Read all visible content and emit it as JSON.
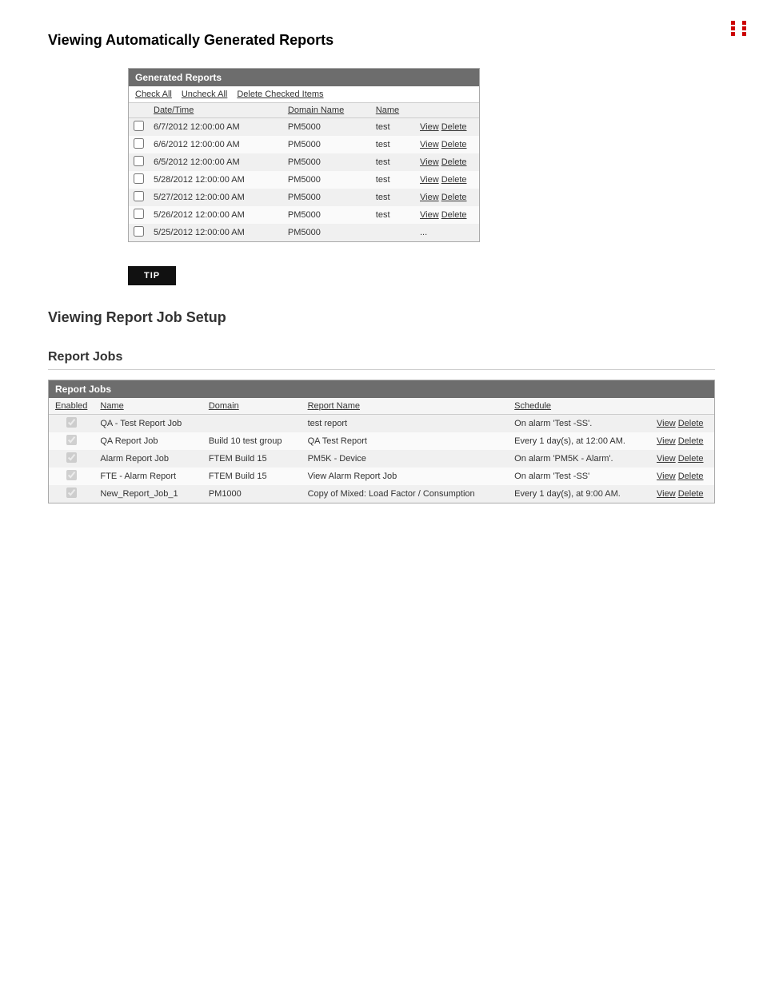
{
  "top_icon": "grid-icon",
  "section1": {
    "title": "Viewing Automatically Generated Reports",
    "table": {
      "header": "Generated Reports",
      "actions": [
        "Check All",
        "Uncheck All",
        "Delete Checked Items"
      ],
      "columns": [
        "Date/Time",
        "Domain Name",
        "Name"
      ],
      "rows": [
        {
          "checked": false,
          "datetime": "6/7/2012 12:00:00 AM",
          "domain": "PM5000",
          "name": "test"
        },
        {
          "checked": false,
          "datetime": "6/6/2012 12:00:00 AM",
          "domain": "PM5000",
          "name": "test"
        },
        {
          "checked": false,
          "datetime": "6/5/2012 12:00:00 AM",
          "domain": "PM5000",
          "name": "test"
        },
        {
          "checked": false,
          "datetime": "5/28/2012 12:00:00 AM",
          "domain": "PM5000",
          "name": "test"
        },
        {
          "checked": false,
          "datetime": "5/27/2012 12:00:00 AM",
          "domain": "PM5000",
          "name": "test"
        },
        {
          "checked": false,
          "datetime": "5/26/2012 12:00:00 AM",
          "domain": "PM5000",
          "name": "test"
        },
        {
          "checked": false,
          "datetime": "5/25/2012 12:00:00 AM",
          "domain": "PM5000",
          "name": ""
        }
      ],
      "row_actions": [
        "View",
        "Delete"
      ]
    }
  },
  "tip_button": "TIP",
  "section2": {
    "title": "Viewing Report Job Setup"
  },
  "report_jobs_heading": "Report Jobs",
  "report_jobs_table": {
    "header": "Report Jobs",
    "columns": [
      "Enabled",
      "Name",
      "Domain",
      "Report Name",
      "Schedule"
    ],
    "rows": [
      {
        "enabled": true,
        "name": "QA - Test Report Job",
        "domain": "",
        "report_name": "test report",
        "schedule": "On alarm 'Test -SS'."
      },
      {
        "enabled": true,
        "name": "QA Report Job",
        "domain": "Build 10 test group",
        "report_name": "QA Test Report",
        "schedule": "Every 1 day(s), at 12:00 AM."
      },
      {
        "enabled": true,
        "name": "Alarm Report Job",
        "domain": "FTEM Build 15",
        "report_name": "PM5K - Device",
        "schedule": "On alarm 'PM5K - Alarm'."
      },
      {
        "enabled": true,
        "name": "FTE - Alarm Report",
        "domain": "FTEM Build 15",
        "report_name": "View Alarm Report Job",
        "schedule": "On alarm 'Test -SS'"
      },
      {
        "enabled": true,
        "name": "New_Report_Job_1",
        "domain": "PM1000",
        "report_name": "Copy of Mixed: Load Factor / Consumption",
        "schedule": "Every 1 day(s), at 9:00 AM."
      }
    ],
    "row_actions": [
      "View",
      "Delete"
    ]
  }
}
